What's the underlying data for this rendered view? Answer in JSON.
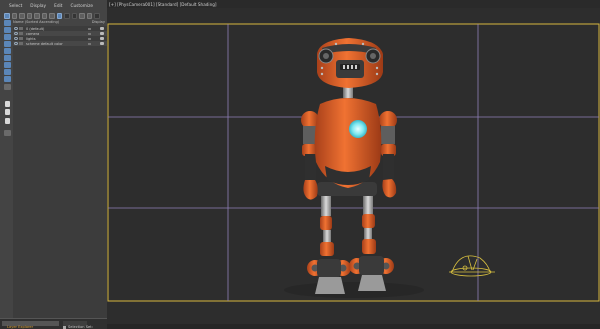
{
  "menubar": {
    "items": [
      "Select",
      "Display",
      "Edit",
      "Customize"
    ]
  },
  "explorer": {
    "column_header": {
      "name": "Name (Sorted Ascending)",
      "display": "Display"
    },
    "rows": [
      {
        "label": "0 (default)"
      },
      {
        "label": "camera"
      },
      {
        "label": "lights"
      },
      {
        "label": "scheme default color"
      }
    ]
  },
  "statusbar": {
    "layer_explorer": "Layer Explorer",
    "selection_set": "Selection Set:"
  },
  "viewport": {
    "label": "[+] [PhysCamera001] [Standard] [Default Shading]"
  },
  "colors": {
    "panel_bg": "#444444",
    "viewport_bg": "#2d2d2d",
    "viewport_border": "#d8b840",
    "robot_orange": "#e8662a",
    "accent_blue": "#5b86b8",
    "safe_frame": "#8f7fb8"
  }
}
